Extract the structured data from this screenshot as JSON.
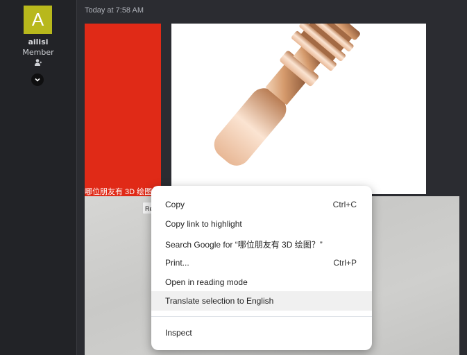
{
  "user": {
    "avatar_letter": "A",
    "avatar_color": "#b8b81c",
    "name": "ailisi",
    "role": "Member"
  },
  "message": {
    "timestamp": "Today at 7:58 AM",
    "red_image_caption": "哪位朋友有 3D 绘图",
    "chip_text": "Re"
  },
  "context_menu": {
    "items": [
      {
        "label": "Copy",
        "shortcut": "Ctrl+C"
      },
      {
        "label": "Copy link to highlight",
        "shortcut": ""
      },
      {
        "label": "Search Google for “哪位朋友有 3D 绘图？”",
        "shortcut": ""
      },
      {
        "label": "Print...",
        "shortcut": "Ctrl+P"
      },
      {
        "label": "Open in reading mode",
        "shortcut": ""
      },
      {
        "label": "Translate selection to English",
        "shortcut": ""
      },
      {
        "label": "Inspect",
        "shortcut": ""
      }
    ],
    "hovered_index": 5
  },
  "colors": {
    "red_block": "#e02a17",
    "accent_avatar": "#b8b81c"
  }
}
